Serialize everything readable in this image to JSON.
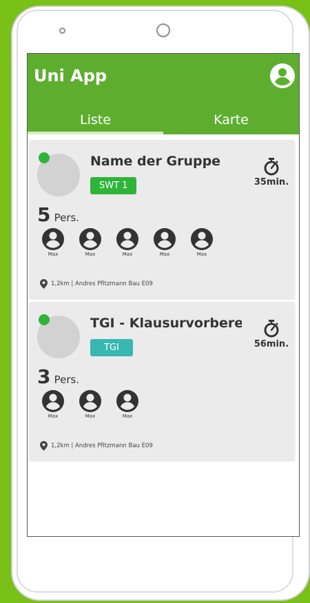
{
  "app": {
    "title": "Uni App",
    "profile_icon": "account-circle-icon",
    "bar_color": "#5dae2f"
  },
  "tabs": [
    {
      "label": "Liste",
      "active": true
    },
    {
      "label": "Karte",
      "active": false
    }
  ],
  "groups": [
    {
      "name": "Name der Gruppe",
      "tag": "SWT 1",
      "tag_color": "#2fb43a",
      "time": "35min.",
      "count": "5",
      "count_unit": "Pers.",
      "members": [
        "Max",
        "Max",
        "Max",
        "Max",
        "Max"
      ],
      "location": "1,2km | Andres Pfitzmann Bau E09",
      "online": true
    },
    {
      "name": "TGI - Klausurvorbereit..",
      "tag": "TGI",
      "tag_color": "#38b7b1",
      "time": "56min.",
      "count": "3",
      "count_unit": "Pers.",
      "members": [
        "Max",
        "Max",
        "Max"
      ],
      "location": "1,2km | Andres Pfitzmann Bau E09",
      "online": true
    }
  ]
}
